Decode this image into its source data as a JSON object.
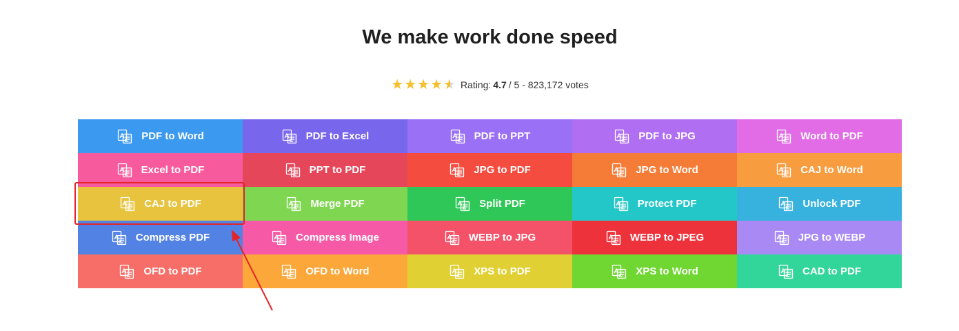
{
  "heading": "We make work done speed",
  "rating": {
    "label": "Rating:",
    "score": "4.7",
    "rest": "/ 5 - 823,172 votes",
    "stars": 4.7
  },
  "tiles": [
    {
      "label": "PDF to Word",
      "color": "#3b99f0",
      "icon": "pdf-word-icon"
    },
    {
      "label": "PDF to Excel",
      "color": "#7866ec",
      "icon": "pdf-excel-icon"
    },
    {
      "label": "PDF to PPT",
      "color": "#9a70f6",
      "icon": "pdf-ppt-icon"
    },
    {
      "label": "PDF to JPG",
      "color": "#b06ef3",
      "icon": "pdf-jpg-icon"
    },
    {
      "label": "Word to PDF",
      "color": "#e16ce6",
      "icon": "word-pdf-icon"
    },
    {
      "label": "Excel to PDF",
      "color": "#f75a9d",
      "icon": "excel-pdf-icon"
    },
    {
      "label": "PPT to PDF",
      "color": "#e6465a",
      "icon": "ppt-pdf-icon"
    },
    {
      "label": "JPG to PDF",
      "color": "#f44c3f",
      "icon": "jpg-pdf-icon"
    },
    {
      "label": "JPG to Word",
      "color": "#f57c36",
      "icon": "jpg-word-icon"
    },
    {
      "label": "CAJ to Word",
      "color": "#f89c40",
      "icon": "caj-word-icon"
    },
    {
      "label": "CAJ to PDF",
      "color": "#e8c33e",
      "icon": "caj-pdf-icon"
    },
    {
      "label": "Merge PDF",
      "color": "#7fd651",
      "icon": "merge-pdf-icon"
    },
    {
      "label": "Split PDF",
      "color": "#2fc858",
      "icon": "split-pdf-icon"
    },
    {
      "label": "Protect PDF",
      "color": "#24c7c8",
      "icon": "protect-pdf-icon"
    },
    {
      "label": "Unlock PDF",
      "color": "#37b1de",
      "icon": "unlock-pdf-icon"
    },
    {
      "label": "Compress PDF",
      "color": "#5282e3",
      "icon": "compress-pdf-icon"
    },
    {
      "label": "Compress Image",
      "color": "#f65aa6",
      "icon": "compress-image-icon"
    },
    {
      "label": "WEBP to JPG",
      "color": "#f35268",
      "icon": "webp-jpg-icon"
    },
    {
      "label": "WEBP to JPEG",
      "color": "#ee323b",
      "icon": "webp-jpeg-icon"
    },
    {
      "label": "JPG to WEBP",
      "color": "#a98af5",
      "icon": "jpg-webp-icon"
    },
    {
      "label": "OFD to PDF",
      "color": "#f66e67",
      "icon": "ofd-pdf-icon"
    },
    {
      "label": "OFD to Word",
      "color": "#fba73a",
      "icon": "ofd-word-icon"
    },
    {
      "label": "XPS to PDF",
      "color": "#e0d033",
      "icon": "xps-pdf-icon"
    },
    {
      "label": "XPS to Word",
      "color": "#6fd632",
      "icon": "xps-word-icon"
    },
    {
      "label": "CAD to PDF",
      "color": "#33d69a",
      "icon": "cad-pdf-icon"
    }
  ],
  "annotation": {
    "highlight_color": "#e5242a"
  }
}
